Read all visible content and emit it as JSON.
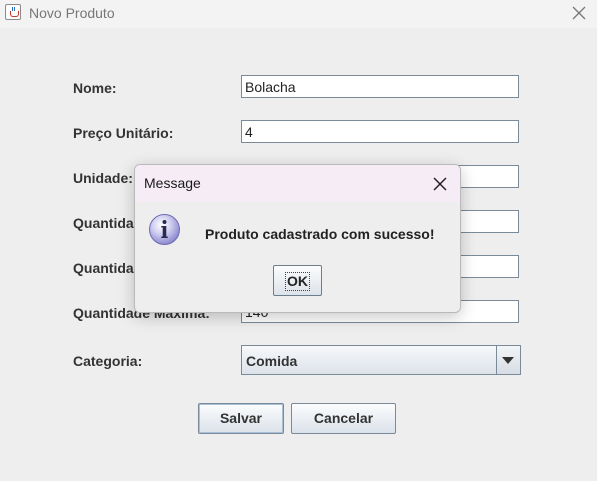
{
  "window": {
    "title": "Novo Produto",
    "icon": "java-cup-icon",
    "close_icon": "close-icon"
  },
  "form": {
    "nome_label": "Nome:",
    "nome_value": "Bolacha",
    "preco_label": "Preço Unitário:",
    "preco_value": "4",
    "unidade_label": "Unidade:",
    "unidade_value": "",
    "qtd_estoque_label": "Quantida",
    "qtd_estoque_value": "",
    "qtd_minima_label": "Quantida",
    "qtd_minima_value": "",
    "qtd_maxima_label": "Quantidade Máxima:",
    "qtd_maxima_value": "140",
    "categoria_label": "Categoria:",
    "categoria_value": "Comida",
    "save_label": "Salvar",
    "cancel_label": "Cancelar"
  },
  "dialog": {
    "title": "Message",
    "message": "Produto cadastrado com sucesso!",
    "ok_label": "OK",
    "icon": "info-icon"
  },
  "colors": {
    "background": "#eeeeee",
    "dialog_titlebar": "#f6ecf6",
    "info_icon": "#9b97d6",
    "field_border": "#7a8a99"
  }
}
